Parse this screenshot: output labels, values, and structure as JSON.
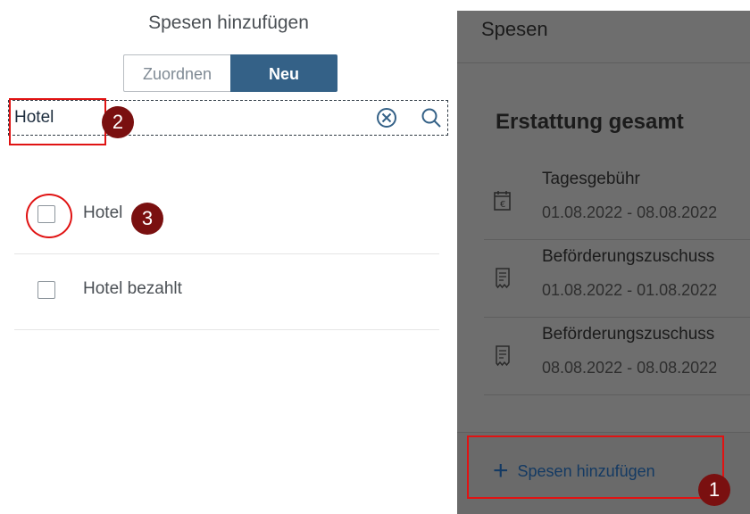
{
  "dialog": {
    "title": "Spesen hinzufügen",
    "segmented": {
      "option_1": "Zuordnen",
      "option_2": "Neu",
      "selected": "Neu"
    },
    "search": {
      "value": "Hotel"
    },
    "results": [
      {
        "label": "Hotel",
        "checked": false
      },
      {
        "label": "Hotel bezahlt",
        "checked": false
      }
    ]
  },
  "panel": {
    "title": "Spesen",
    "section_title": "Erstattung gesamt",
    "items": [
      {
        "title": "Tagesgebühr",
        "date": "01.08.2022 - 08.08.2022",
        "icon": "calendar-euro-icon"
      },
      {
        "title": "Beförderungszuschuss",
        "date": "01.08.2022 - 01.08.2022",
        "icon": "receipt-icon"
      },
      {
        "title": "Beförderungszuschuss",
        "date": "08.08.2022 - 08.08.2022",
        "icon": "receipt-icon"
      }
    ],
    "add_button": {
      "icon": "plus-icon",
      "label": "Spesen hinzufügen"
    }
  },
  "annotations": {
    "step_1": "1",
    "step_2": "2",
    "step_3": "3",
    "color": "#e01313",
    "badge_color": "#7a1010"
  },
  "colors": {
    "primary": "#346187",
    "overlay": "#6e6e6e"
  }
}
